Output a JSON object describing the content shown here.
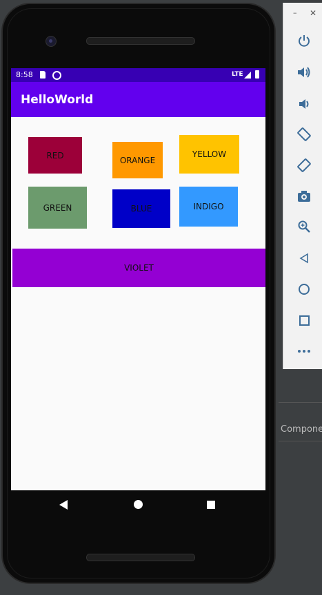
{
  "status_bar": {
    "time": "8:58",
    "network": "LTE"
  },
  "app": {
    "title": "HelloWorld"
  },
  "buttons": {
    "red": {
      "label": "RED",
      "color": "#9c0039"
    },
    "orange": {
      "label": "ORANGE",
      "color": "#ff9800"
    },
    "yellow": {
      "label": "YELLOW",
      "color": "#ffc300"
    },
    "green": {
      "label": "GREEN",
      "color": "#6c9b6d"
    },
    "blue": {
      "label": "BLUE",
      "color": "#0000c8"
    },
    "indigo": {
      "label": "INDIGO",
      "color": "#3399ff"
    },
    "violet": {
      "label": "VIOLET",
      "color": "#9400d3"
    }
  },
  "colors": {
    "status_bar": "#3700b3",
    "app_bar": "#6200ee",
    "screen_bg": "#fafafa"
  },
  "emulator_toolbar": {
    "icons": [
      "power-icon",
      "volume-up-icon",
      "volume-down-icon",
      "rotate-left-icon",
      "rotate-right-icon",
      "camera-icon",
      "zoom-icon",
      "back-icon",
      "home-icon",
      "overview-icon",
      "more-icon"
    ]
  },
  "ide": {
    "panel_label": "Compone"
  }
}
